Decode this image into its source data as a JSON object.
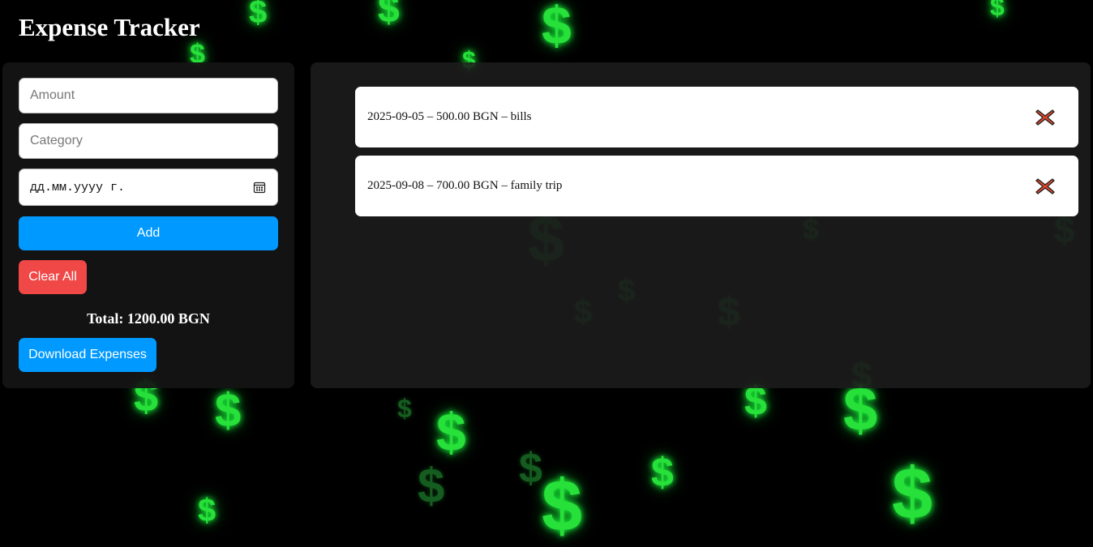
{
  "app": {
    "title": "Expense Tracker"
  },
  "form": {
    "amount_placeholder": "Amount",
    "category_placeholder": "Category",
    "date_placeholder": "дд.мм.уууу г.",
    "add_label": "Add",
    "clear_label": "Clear All",
    "total_text": "Total: 1200.00 BGN",
    "download_label": "Download Expenses"
  },
  "expenses": [
    {
      "text": "2025-09-05 – 500.00 BGN – bills",
      "delete_icon": "delete-x-icon"
    },
    {
      "text": "2025-09-08 – 700.00 BGN – family trip",
      "delete_icon": "delete-x-icon"
    }
  ],
  "colors": {
    "accent_blue": "#0099ff",
    "danger_red": "#f04747",
    "background": "#000000",
    "dollar_green": "#27e03a"
  },
  "background_icon": "dollar-sign-icon"
}
